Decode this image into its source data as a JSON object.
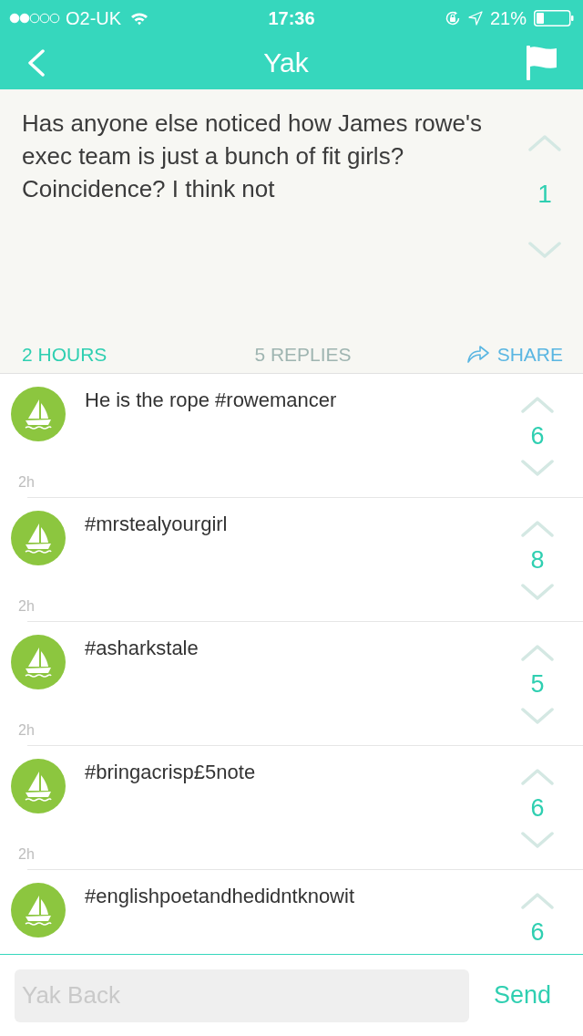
{
  "status_bar": {
    "carrier": "O2-UK",
    "time": "17:36",
    "battery": "21%"
  },
  "nav": {
    "title": "Yak"
  },
  "post": {
    "text": "Has anyone else noticed how James rowe's exec team is just a bunch of fit girls? Coincidence? I think not",
    "score": "1",
    "age": "2 HOURS",
    "replies": "5 REPLIES",
    "share": "SHARE"
  },
  "replies": [
    {
      "text": "He is the rope #rowemancer",
      "score": "6",
      "time": "2h"
    },
    {
      "text": "#mrstealyourgirl",
      "score": "8",
      "time": "2h"
    },
    {
      "text": "#asharkstale",
      "score": "5",
      "time": "2h"
    },
    {
      "text": "#bringacrisp£5note",
      "score": "6",
      "time": "2h"
    },
    {
      "text": "#englishpoetandhedidntknowit",
      "score": "6"
    }
  ],
  "composer": {
    "placeholder": "Yak Back",
    "send": "Send"
  }
}
